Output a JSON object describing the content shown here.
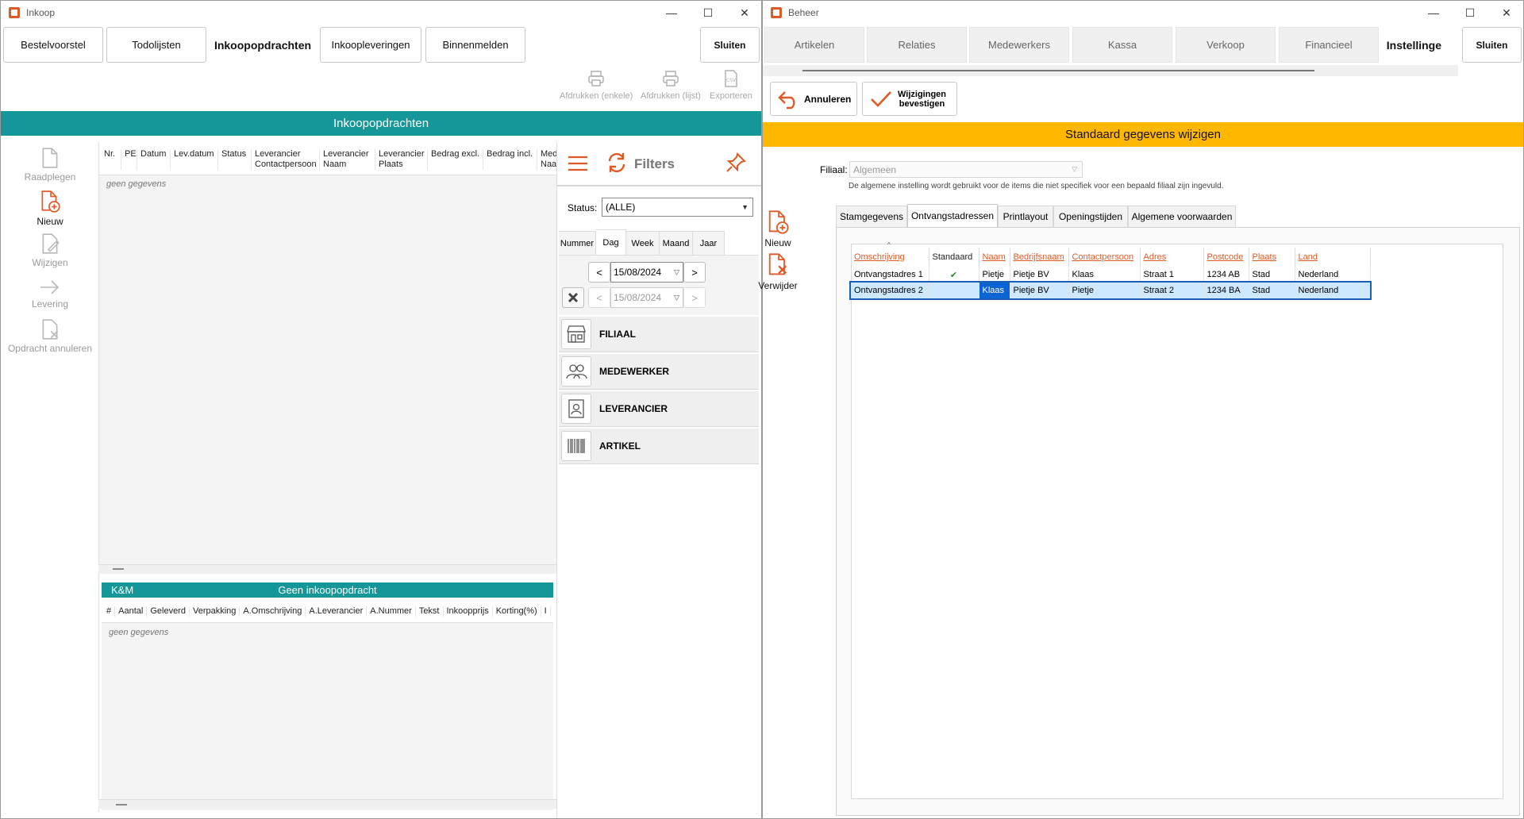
{
  "left": {
    "title": "Inkoop",
    "tabs": [
      "Bestelvoorstel",
      "Todolijsten",
      "Inkoopopdrachten",
      "Inkoopleveringen",
      "Binnenmelden"
    ],
    "close_label": "Sluiten",
    "toolbar": {
      "print_single": "Afdrukken (enkele)",
      "print_list": "Afdrukken (lijst)",
      "export": "Exporteren",
      "csv_text": "CSV"
    },
    "section_title": "Inkoopopdrachten",
    "side": {
      "view": "Raadplegen",
      "new": "Nieuw",
      "edit": "Wijzigen",
      "delivery": "Levering",
      "cancel": "Opdracht annuleren"
    },
    "orders_columns": [
      [
        "Nr.",
        ""
      ],
      [
        "PE",
        ""
      ],
      [
        "Datum",
        ""
      ],
      [
        "Lev.datum",
        ""
      ],
      [
        "Status",
        ""
      ],
      [
        "Leverancier",
        "Contactpersoon"
      ],
      [
        "Leverancier",
        "Naam"
      ],
      [
        "Leverancier",
        "Plaats"
      ],
      [
        "Bedrag excl.",
        ""
      ],
      [
        "Bedrag incl.",
        ""
      ],
      [
        "Mede",
        "Naam"
      ]
    ],
    "empty_text": "geen gegevens",
    "detail": {
      "company": "K&M",
      "title": "Geen inkoopopdracht",
      "columns": [
        "#",
        "Aantal",
        "Geleverd",
        "Verpakking",
        "A.Omschrijving",
        "A.Leverancier",
        "A.Nummer",
        "Tekst",
        "Inkoopprijs",
        "Korting(%)",
        "I"
      ],
      "empty_text": "geen gegevens"
    },
    "filters": {
      "title": "Filters",
      "status_label": "Status:",
      "status_value": "(ALLE)",
      "period_tabs": [
        "Nummer",
        "Dag",
        "Week",
        "Maand",
        "Jaar"
      ],
      "date_from": "15/08/2024",
      "date_to": "15/08/2024",
      "prev": "<",
      "next": ">",
      "sections": [
        "FILIAAL",
        "MEDEWERKER",
        "LEVERANCIER",
        "ARTIKEL"
      ]
    }
  },
  "right": {
    "title": "Beheer",
    "tabs": [
      "Artikelen",
      "Relaties",
      "Medewerkers",
      "Kassa",
      "Verkoop",
      "Financieel",
      "Instellinge"
    ],
    "close_label": "Sluiten",
    "cancel_label": "Annuleren",
    "confirm_label_1": "Wijzigingen",
    "confirm_label_2": "bevestigen",
    "section_title": "Standaard gegevens wijzigen",
    "filiaal_label": "Filiaal:",
    "filiaal_value": "Algemeen",
    "hint": "De algemene instelling wordt gebruikt voor de items die niet specifiek voor een bepaald filiaal zijn ingevuld.",
    "side": {
      "new": "Nieuw",
      "delete": "Verwijder"
    },
    "inner_tabs": [
      "Stamgegevens",
      "Ontvangstadressen",
      "Printlayout",
      "Openingstijden",
      "Algemene voorwaarden"
    ],
    "table": {
      "columns": [
        "Omschrijving",
        "Standaard",
        "Naam",
        "Bedrijfsnaam",
        "Contactpersoon",
        "Adres",
        "Postcode",
        "Plaats",
        "Land"
      ],
      "rows": [
        [
          "Ontvangstadres 1",
          "✔",
          "Pietje",
          "Pietje BV",
          "Klaas",
          "Straat 1",
          "1234 AB",
          "Stad",
          "Nederland"
        ],
        [
          "Ontvangstadres 2",
          "",
          "Klaas",
          "Pietje BV",
          "Pietje",
          "Straat 2",
          "1234 BA",
          "Stad",
          "Nederland"
        ]
      ]
    }
  },
  "colors": {
    "teal": "#15979a",
    "amber": "#ffb700",
    "accent": "#e05a27"
  },
  "window_controls": {
    "minimize": "—",
    "maximize": "☐",
    "close": "✕"
  }
}
